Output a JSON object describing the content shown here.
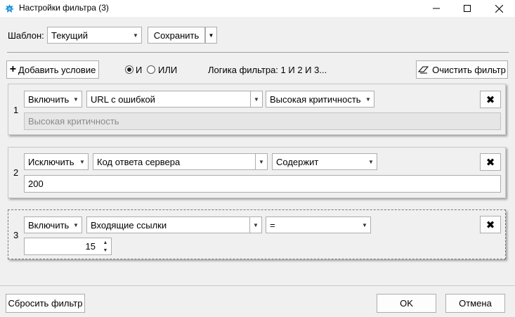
{
  "window": {
    "title": "Настройки фильтра (3)",
    "minimize_icon": "minimize-icon",
    "maximize_icon": "maximize-icon",
    "close_icon": "close-icon"
  },
  "template": {
    "label": "Шаблон:",
    "selected": "Текущий",
    "save_label": "Сохранить"
  },
  "toolbar": {
    "add_condition": "Добавить условие",
    "radio_and": "И",
    "radio_or": "ИЛИ",
    "selected_logic": "И",
    "logic_text": "Логика фильтра: 1 И 2 И 3...",
    "clear_filter": "Очистить фильтр"
  },
  "conditions": [
    {
      "index": "1",
      "mode": "Включить",
      "field": "URL с ошибкой",
      "operator": "Высокая критичность",
      "value": "Высокая критичность",
      "value_disabled": true
    },
    {
      "index": "2",
      "mode": "Исключить",
      "field": "Код ответа сервера",
      "operator": "Содержит",
      "value": "200"
    },
    {
      "index": "3",
      "mode": "Включить",
      "field": "Входящие ссылки",
      "operator": "=",
      "value": "15"
    }
  ],
  "footer": {
    "reset": "Сбросить фильтр",
    "ok": "OK",
    "cancel": "Отмена"
  },
  "colors": {
    "background": "#f0f0f0",
    "titlebar": "#ffffff",
    "border": "#adadad",
    "app_icon": "#1e8fd6"
  }
}
